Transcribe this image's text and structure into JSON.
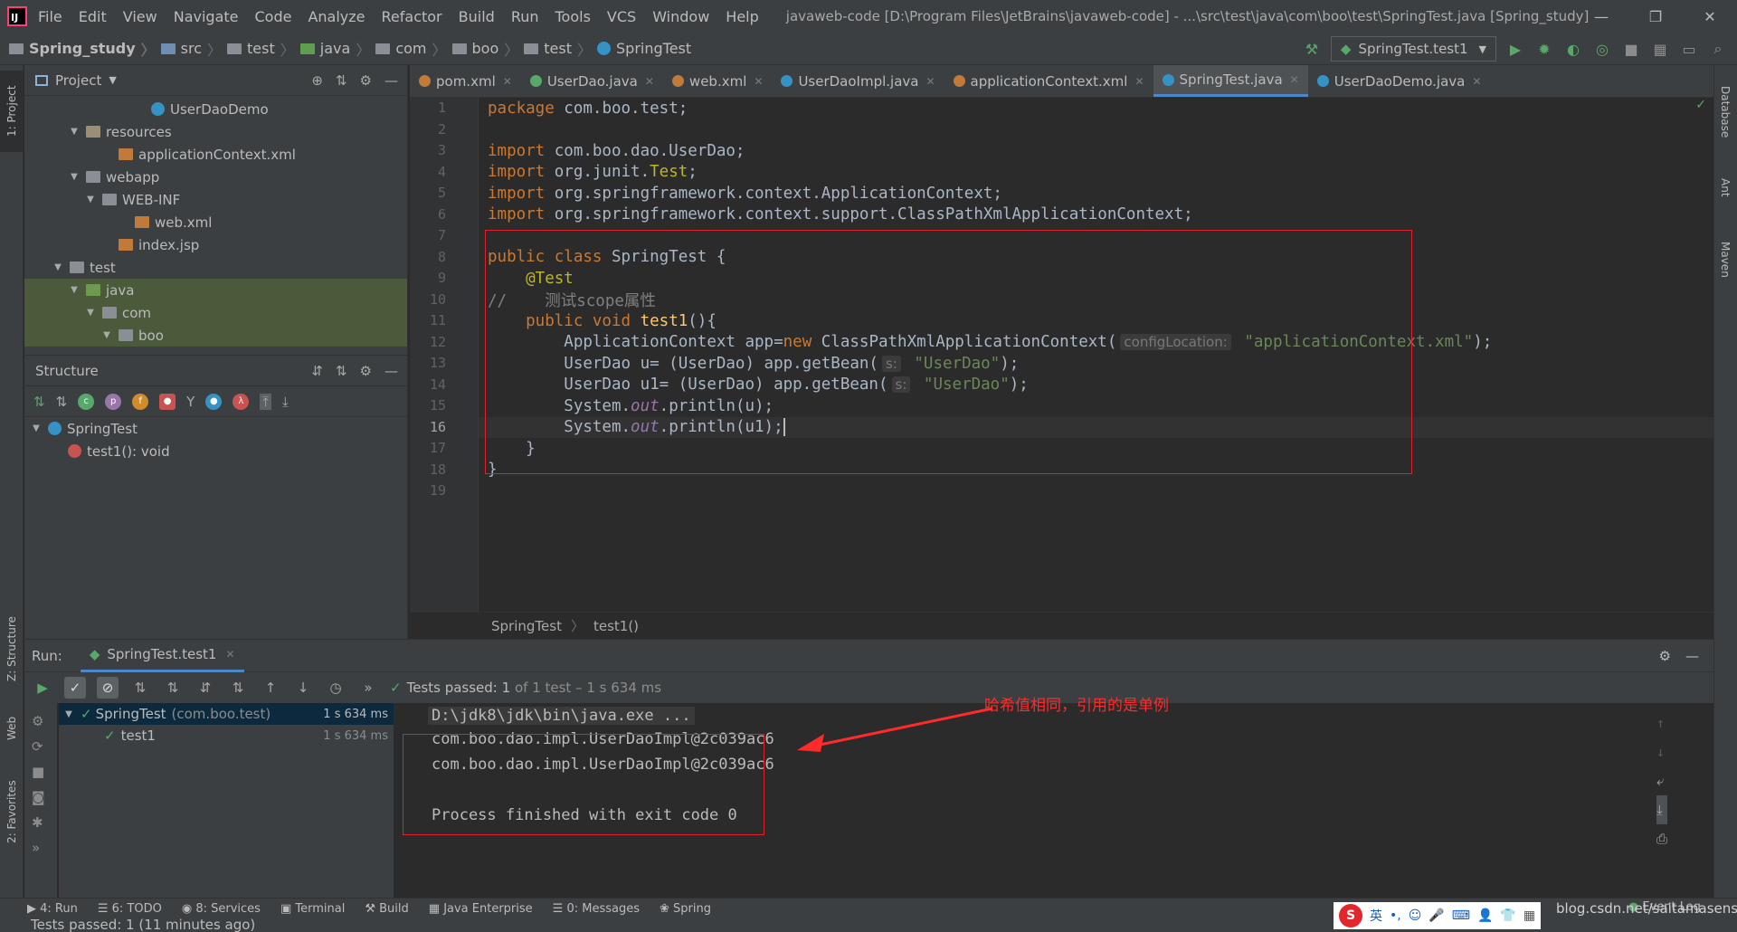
{
  "window": {
    "title": "javaweb-code [D:\\Program Files\\JetBrains\\javaweb-code] - ...\\src\\test\\java\\com\\boo\\test\\SpringTest.java [Spring_study]",
    "logo": "IJ",
    "controls": {
      "minimize": "—",
      "restore": "❐",
      "close": "✕"
    }
  },
  "menu": [
    "File",
    "Edit",
    "View",
    "Navigate",
    "Code",
    "Analyze",
    "Refactor",
    "Build",
    "Run",
    "Tools",
    "VCS",
    "Window",
    "Help"
  ],
  "breadcrumbs": [
    {
      "label": "Spring_study",
      "kind": "module"
    },
    {
      "label": "src",
      "kind": "src"
    },
    {
      "label": "test",
      "kind": "folder"
    },
    {
      "label": "java",
      "kind": "test"
    },
    {
      "label": "com",
      "kind": "folder"
    },
    {
      "label": "boo",
      "kind": "folder"
    },
    {
      "label": "test",
      "kind": "folder"
    },
    {
      "label": "SpringTest",
      "kind": "class"
    }
  ],
  "run_config": "SpringTest.test1",
  "project_panel": {
    "title": "Project",
    "tree": [
      {
        "label": "UserDaoDemo",
        "depth": 7,
        "icon": "cls",
        "arrow": ""
      },
      {
        "label": "resources",
        "depth": 3,
        "icon": "res",
        "arrow": "▼"
      },
      {
        "label": "applicationContext.xml",
        "depth": 5,
        "icon": "xml",
        "arrow": ""
      },
      {
        "label": "webapp",
        "depth": 3,
        "icon": "folder",
        "arrow": "▼"
      },
      {
        "label": "WEB-INF",
        "depth": 4,
        "icon": "folder",
        "arrow": "▼"
      },
      {
        "label": "web.xml",
        "depth": 6,
        "icon": "xml",
        "arrow": ""
      },
      {
        "label": "index.jsp",
        "depth": 5,
        "icon": "jsp",
        "arrow": ""
      },
      {
        "label": "test",
        "depth": 2,
        "icon": "folder",
        "arrow": "▼"
      },
      {
        "label": "java",
        "depth": 3,
        "icon": "java",
        "arrow": "▼",
        "selected": true
      },
      {
        "label": "com",
        "depth": 4,
        "icon": "folder",
        "arrow": "▼",
        "selected": true
      },
      {
        "label": "boo",
        "depth": 5,
        "icon": "folder",
        "arrow": "▼",
        "selected": true
      }
    ]
  },
  "structure_panel": {
    "title": "Structure",
    "class_name": "SpringTest",
    "method": "test1(): void"
  },
  "tabs": [
    {
      "label": "pom.xml",
      "color": "#c07a3a",
      "active": false
    },
    {
      "label": "UserDao.java",
      "color": "#59a869",
      "active": false
    },
    {
      "label": "web.xml",
      "color": "#c07a3a",
      "active": false
    },
    {
      "label": "UserDaoImpl.java",
      "color": "#3592c4",
      "active": false
    },
    {
      "label": "applicationContext.xml",
      "color": "#c07a3a",
      "active": false
    },
    {
      "label": "SpringTest.java",
      "color": "#3592c4",
      "active": true
    },
    {
      "label": "UserDaoDemo.java",
      "color": "#3592c4",
      "active": false
    }
  ],
  "editor": {
    "line_numbers": [
      "1",
      "2",
      "3",
      "4",
      "5",
      "6",
      "7",
      "8",
      "9",
      "10",
      "11",
      "12",
      "13",
      "14",
      "15",
      "16",
      "17",
      "18",
      "19"
    ],
    "current_line": 16,
    "breadcrumb": {
      "class": "SpringTest",
      "method": "test1()"
    },
    "code": {
      "l1": {
        "kw": "package",
        "rest": " com.boo.test;"
      },
      "l3": {
        "kw": "import",
        "rest": " com.boo.dao.UserDao;"
      },
      "l4": {
        "kw": "import",
        "rest": " org.junit.",
        "ann": "Test",
        ";": ";"
      },
      "l5": {
        "kw": "import",
        "rest": " org.springframework.context.ApplicationContext;"
      },
      "l6": {
        "kw": "import",
        "rest": " org.springframework.context.support.ClassPathXmlApplicationContext;"
      },
      "l8": {
        "kw": "public class",
        "rest": " SpringTest {"
      },
      "l9": {
        "ann": "    @Test"
      },
      "l10": {
        "cmt": "//    测试scope属性"
      },
      "l11": {
        "kw": "    public void",
        "fn": " test1",
        "rest": "(){"
      },
      "l12": {
        "a": "        ApplicationContext app=",
        "kw": "new",
        "b": " ClassPathXmlApplicationContext(",
        "hint": "configLocation:",
        "str": " \"applicationContext.xml\"",
        "c": ");"
      },
      "l13": {
        "a": "        UserDao u= (UserDao) app.getBean(",
        "hint": "s:",
        "str": " \"UserDao\"",
        "c": ");"
      },
      "l14": {
        "a": "        UserDao u1= (UserDao) app.getBean(",
        "hint": "s:",
        "str": " \"UserDao\"",
        "c": ");"
      },
      "l15": {
        "a": "        System.",
        "fld": "out",
        "b": ".println(u);"
      },
      "l16": {
        "a": "        System.",
        "fld": "out",
        "b": ".println(u1);"
      },
      "l17": {
        "rest": "    }"
      },
      "l18": {
        "rest": "}"
      }
    }
  },
  "run": {
    "label": "Run:",
    "tab": "SpringTest.test1",
    "summary_prefix": "Tests passed:",
    "summary_count": "1",
    "summary_rest": "of 1 test – 1 s 634 ms",
    "tree": [
      {
        "label": "SpringTest",
        "sub": "(com.boo.test)",
        "time": "1 s 634 ms"
      },
      {
        "label": "test1",
        "sub": "",
        "time": "1 s 634 ms"
      }
    ],
    "console": [
      "D:\\jdk8\\jdk\\bin\\java.exe ...",
      "com.boo.dao.impl.UserDaoImpl@2c039ac6",
      "com.boo.dao.impl.UserDaoImpl@2c039ac6",
      "",
      "Process finished with exit code 0"
    ],
    "annotation": "哈希值相同，引用的是单例"
  },
  "left_strip": [
    "1: Project",
    "Z: Structure",
    "Web",
    "2: Favorites"
  ],
  "right_strip": [
    "Database",
    "Ant",
    "Maven"
  ],
  "bottom_tabs": [
    "4: Run",
    "6: TODO",
    "8: Services",
    "Terminal",
    "Build",
    "Java Enterprise",
    "0: Messages",
    "Spring",
    "Event Log"
  ],
  "status": "Tests passed: 1 (11 minutes ago)",
  "watermark": "blog.csdn.net/saitamasensei",
  "ime": {
    "logo": "S",
    "lang": "英"
  },
  "colors": {
    "accent": "#4a88c7",
    "red_box": "#e0202a",
    "pass_green": "#59a869"
  }
}
